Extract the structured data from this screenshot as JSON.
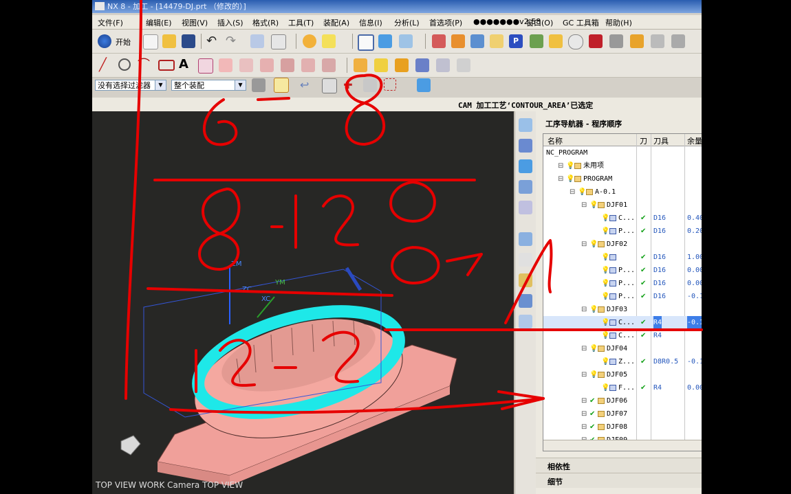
{
  "window": {
    "title": "NX 8 - 加工 - [14479-DJ.prt （修改的）]"
  },
  "menu": [
    "文件(F)",
    "编辑(E)",
    "视图(V)",
    "插入(S)",
    "格式(R)",
    "工具(T)",
    "装配(A)",
    "信息(I)",
    "分析(L)",
    "首选项(P)",
    "●●●●●●●v2.58",
    "窗口(O)",
    "GC 工具箱",
    "帮助(H)"
  ],
  "toolbar": {
    "start_label": "开始"
  },
  "filters": {
    "selection_filter": "没有选择过滤器",
    "scope": "整个装配"
  },
  "status_bar": {
    "message": "CAM 加工工艺‘CONTOUR_AREA’已选定"
  },
  "viewport": {
    "view_label": "TOP VIEW WORK Camera TOP VIEW",
    "axis_labels": [
      "ZM",
      "YM",
      "XC",
      "ZC"
    ]
  },
  "navigator": {
    "title": "工序导航器 - 程序顺序",
    "columns": [
      "名称",
      "刀",
      "刀具",
      "余量"
    ],
    "rows": [
      {
        "name": "NC_PROGRAM",
        "indent": 0,
        "ck": "",
        "tool": "",
        "stock": ""
      },
      {
        "name": "未用项",
        "indent": 1,
        "ck": "",
        "tool": "",
        "stock": ""
      },
      {
        "name": "PROGRAM",
        "indent": 1,
        "ck": "",
        "tool": "",
        "stock": ""
      },
      {
        "name": "A-0.1",
        "indent": 2,
        "ck": "",
        "tool": "",
        "stock": ""
      },
      {
        "name": "DJF01",
        "indent": 3,
        "ck": "",
        "tool": "",
        "stock": ""
      },
      {
        "name": "C...",
        "indent": 4,
        "ck": "✔",
        "tool": "D16",
        "stock": "0.40"
      },
      {
        "name": "P...",
        "indent": 4,
        "ck": "✔",
        "tool": "D16",
        "stock": "0.20"
      },
      {
        "name": "DJF02",
        "indent": 3,
        "ck": "",
        "tool": "",
        "stock": ""
      },
      {
        "name": "",
        "indent": 4,
        "ck": "✔",
        "tool": "D16",
        "stock": "1.00"
      },
      {
        "name": "P...",
        "indent": 4,
        "ck": "✔",
        "tool": "D16",
        "stock": "0.00"
      },
      {
        "name": "P...",
        "indent": 4,
        "ck": "✔",
        "tool": "D16",
        "stock": "0.00"
      },
      {
        "name": "P...",
        "indent": 4,
        "ck": "✔",
        "tool": "D16",
        "stock": "-0.1"
      },
      {
        "name": "DJF03",
        "indent": 3,
        "ck": "",
        "tool": "",
        "stock": ""
      },
      {
        "name": "C...",
        "indent": 4,
        "ck": "✔",
        "tool": "R4",
        "stock": "-0.1",
        "selected": true
      },
      {
        "name": "C...",
        "indent": 4,
        "ck": "✔",
        "tool": "R4",
        "stock": ""
      },
      {
        "name": "DJF04",
        "indent": 3,
        "ck": "",
        "tool": "",
        "stock": ""
      },
      {
        "name": "Z...",
        "indent": 4,
        "ck": "✔",
        "tool": "D8R0.5",
        "stock": "-0.1"
      },
      {
        "name": "DJF05",
        "indent": 3,
        "ck": "",
        "tool": "",
        "stock": ""
      },
      {
        "name": "F...",
        "indent": 4,
        "ck": "✔",
        "tool": "R4",
        "stock": "0.00"
      },
      {
        "name": "DJF06",
        "indent": 3,
        "ck": "✔",
        "tool": "",
        "stock": ""
      },
      {
        "name": "DJF07",
        "indent": 3,
        "ck": "✔",
        "tool": "",
        "stock": ""
      },
      {
        "name": "DJF08",
        "indent": 3,
        "ck": "✔",
        "tool": "",
        "stock": ""
      },
      {
        "name": "DJF09",
        "indent": 3,
        "ck": "✔",
        "tool": "",
        "stock": ""
      }
    ],
    "sections": [
      "相依性",
      "细节"
    ]
  },
  "annotations": {
    "handwriting": [
      "6",
      "8",
      "8-12",
      "8",
      "12-2"
    ]
  },
  "colors": {
    "ink": "#e60000",
    "cyan": "#1ee8e8",
    "part": "#f0a09a",
    "selected": "#3d7ee8"
  }
}
